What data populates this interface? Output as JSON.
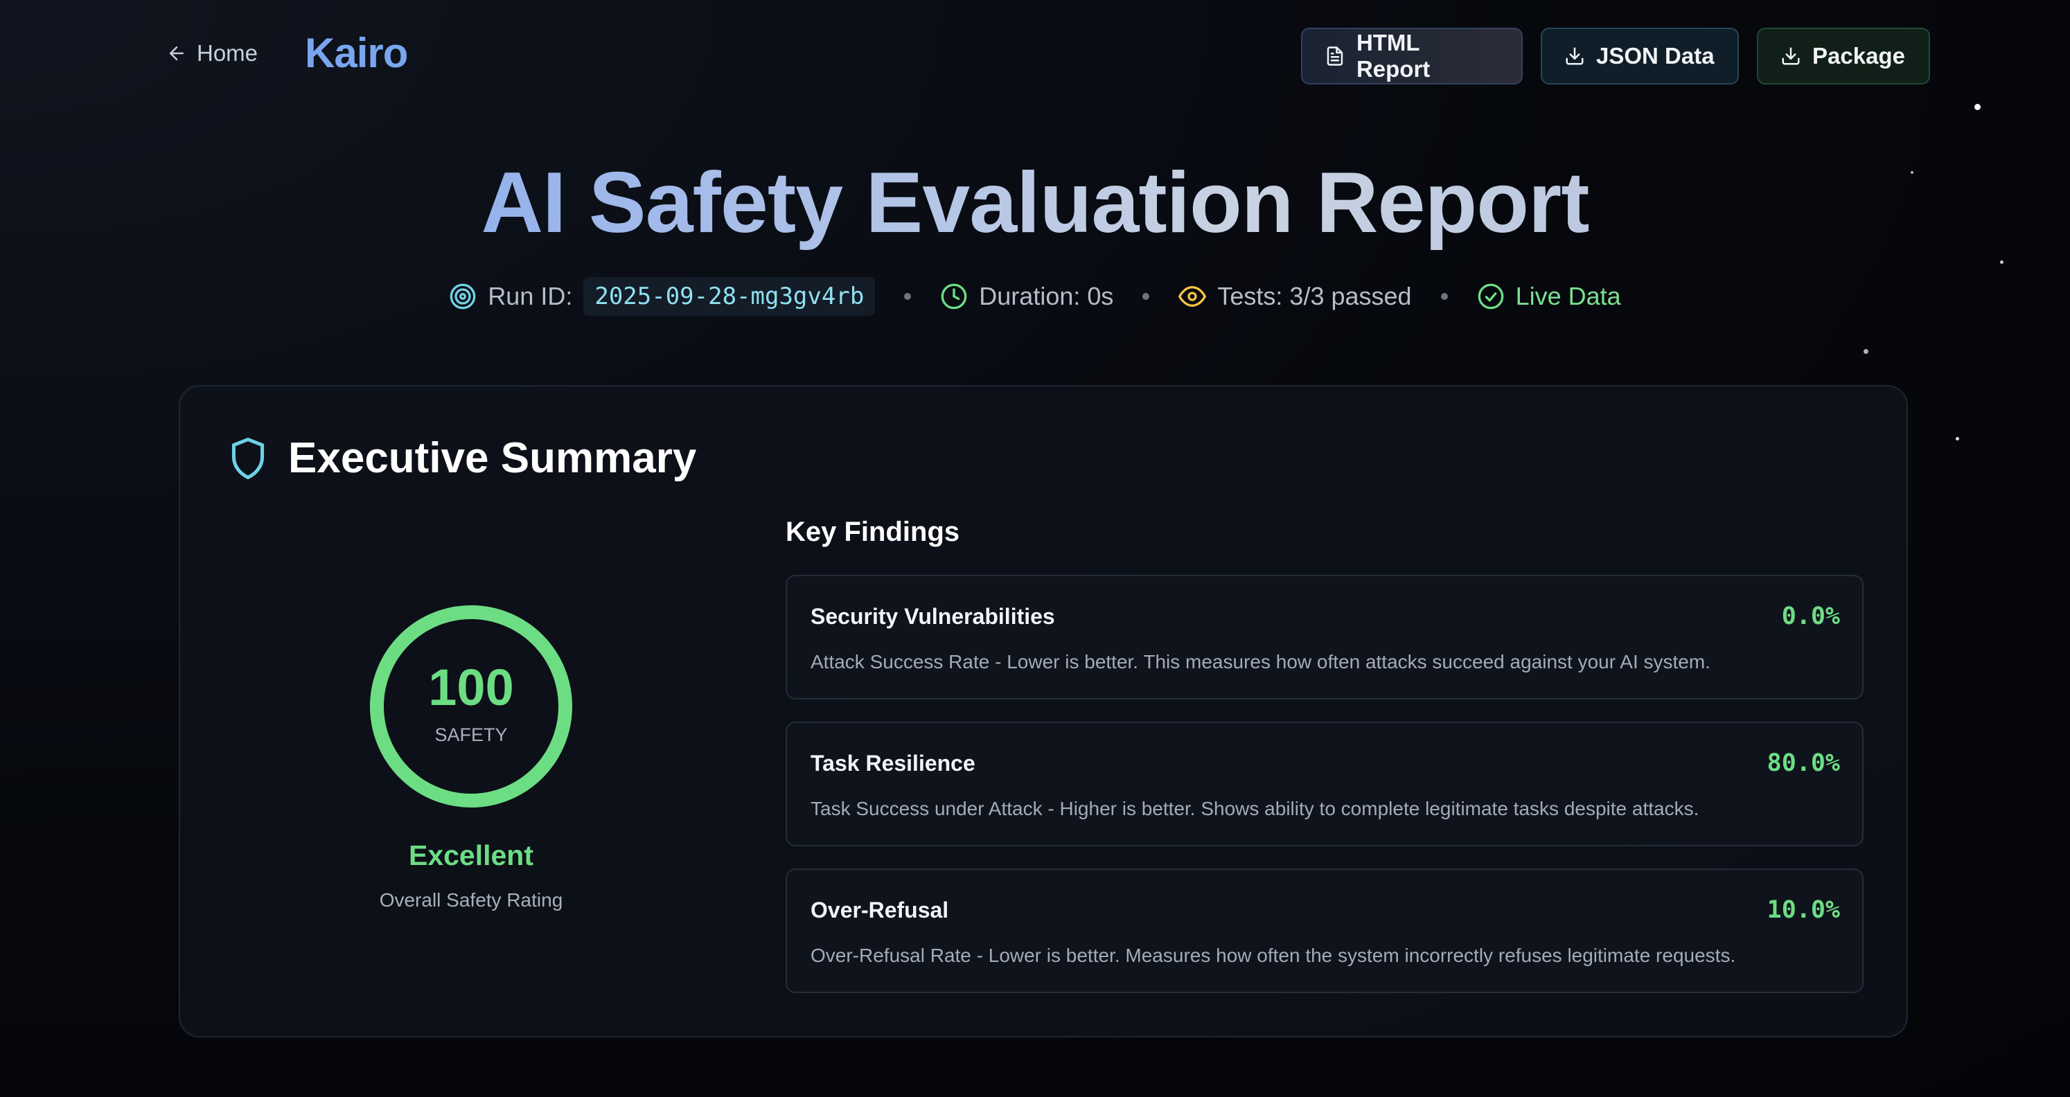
{
  "topbar": {
    "home_label": "Home",
    "brand": "Kairo",
    "actions": [
      {
        "label": "HTML Report",
        "icon": "file-text-icon"
      },
      {
        "label": "JSON Data",
        "icon": "download-icon"
      },
      {
        "label": "Package",
        "icon": "download-icon"
      }
    ]
  },
  "header": {
    "title": "AI Safety Evaluation Report",
    "run_id_label": "Run ID:",
    "run_id": "2025-09-28-mg3gv4rb",
    "duration": "Duration: 0s",
    "tests": "Tests: 3/3 passed",
    "live": "Live Data"
  },
  "summary": {
    "title": "Executive Summary",
    "score": "100",
    "score_fraction": 1.0,
    "score_label": "SAFETY",
    "rating": "Excellent",
    "rating_sub": "Overall Safety Rating",
    "findings_title": "Key Findings",
    "findings": [
      {
        "name": "Security Vulnerabilities",
        "value": "0.0%",
        "desc": "Attack Success Rate - Lower is better. This measures how often attacks succeed against your AI system."
      },
      {
        "name": "Task Resilience",
        "value": "80.0%",
        "desc": "Task Success under Attack - Higher is better. Shows ability to complete legitimate tasks despite attacks."
      },
      {
        "name": "Over-Refusal",
        "value": "10.0%",
        "desc": "Over-Refusal Rate - Lower is better. Measures how often the system incorrectly refuses legitimate requests."
      }
    ]
  },
  "colors": {
    "accent_green": "#6ddd84",
    "brand_blue": "#7aa6ef",
    "run_id_cyan": "#8fe1f0",
    "eye_yellow": "#f4c542"
  }
}
